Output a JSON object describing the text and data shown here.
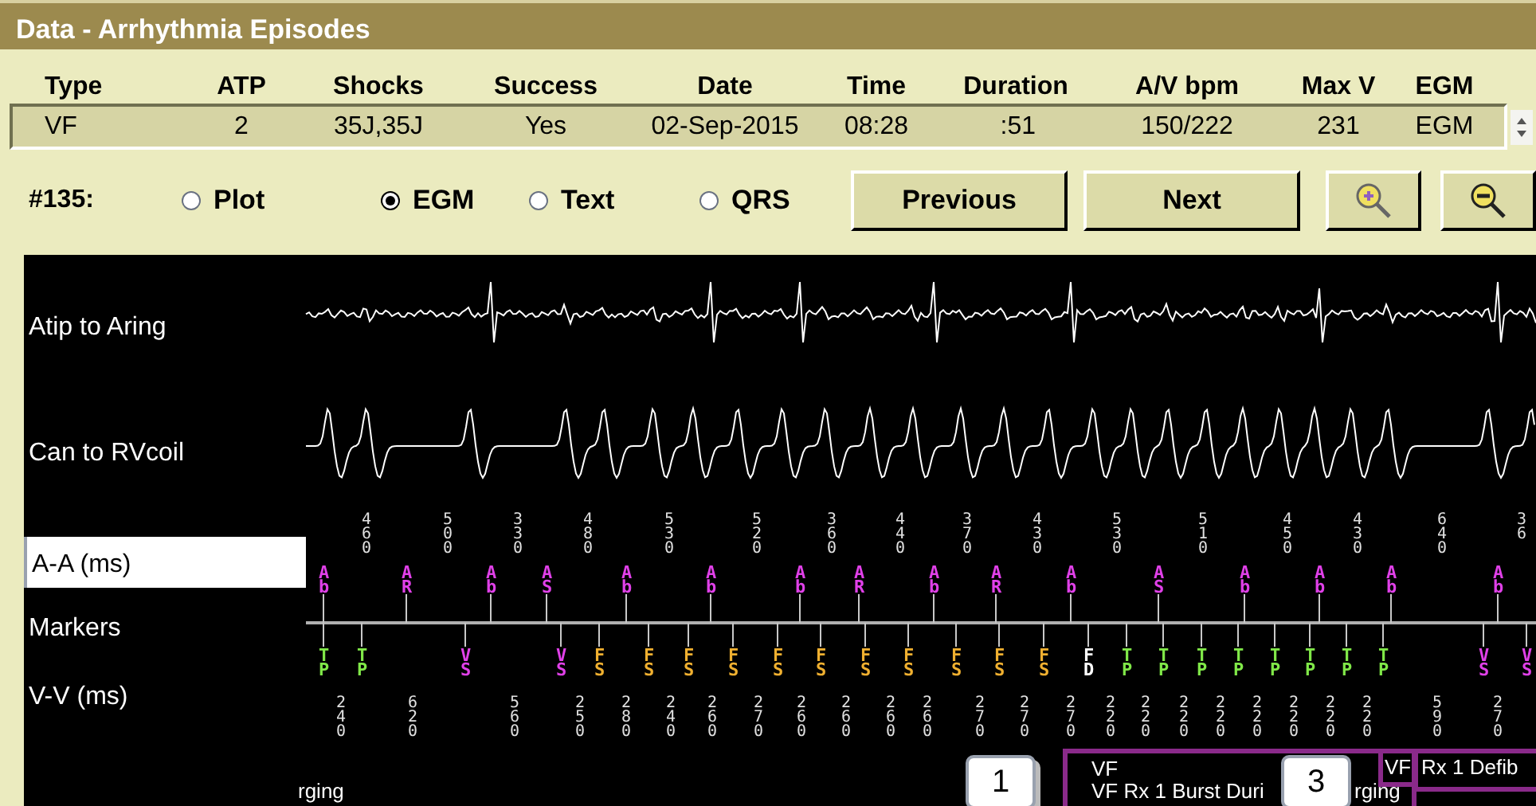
{
  "window": {
    "title": "Data - Arrhythmia Episodes"
  },
  "table": {
    "columns": [
      "Type",
      "ATP",
      "Shocks",
      "Success",
      "Date",
      "Time",
      "Duration",
      "A/V bpm",
      "Max V",
      "EGM"
    ],
    "rows": [
      {
        "cells": [
          "VF",
          "2",
          "35J,35J",
          "Yes",
          "02-Sep-2015",
          "08:28",
          ":51",
          "150/222",
          "231",
          "EGM"
        ],
        "selected": true
      }
    ]
  },
  "episode_label": "#135:",
  "view_options": [
    {
      "label": "Plot",
      "selected": false
    },
    {
      "label": "EGM",
      "selected": true
    },
    {
      "label": "Text",
      "selected": false
    },
    {
      "label": "QRS",
      "selected": false
    }
  ],
  "buttons": [
    "Previous",
    "Next"
  ],
  "channels": [
    {
      "label": "Atip to Aring"
    },
    {
      "label": "Can to RVcoil"
    }
  ],
  "aa": {
    "label": "A-A (ms)",
    "intervals": [
      "460",
      "500",
      "330",
      "480",
      "530",
      "520",
      "360",
      "440",
      "370",
      "430",
      "530",
      "510",
      "450",
      "430",
      "640",
      "36"
    ]
  },
  "markers": {
    "label": "Markers",
    "atrial": [
      {
        "text": "Ab",
        "color": "#e040e8"
      },
      {
        "text": "AR",
        "color": "#e040e8"
      },
      {
        "text": "Ab",
        "color": "#e040e8"
      },
      {
        "text": "AS",
        "color": "#e040e8"
      },
      {
        "text": "Ab",
        "color": "#e040e8"
      },
      {
        "text": "Ab",
        "color": "#e040e8"
      },
      {
        "text": "Ab",
        "color": "#e040e8"
      },
      {
        "text": "AR",
        "color": "#e040e8"
      },
      {
        "text": "Ab",
        "color": "#e040e8"
      },
      {
        "text": "AR",
        "color": "#e040e8"
      },
      {
        "text": "Ab",
        "color": "#e040e8"
      },
      {
        "text": "AS",
        "color": "#e040e8"
      },
      {
        "text": "Ab",
        "color": "#e040e8"
      },
      {
        "text": "Ab",
        "color": "#e040e8"
      },
      {
        "text": "Ab",
        "color": "#e040e8"
      },
      {
        "text": "Ab",
        "color": "#e040e8"
      }
    ],
    "ventricular": [
      {
        "text": "TP",
        "color": "#80e848"
      },
      {
        "text": "TP",
        "color": "#80e848"
      },
      {
        "text": "VS",
        "color": "#e040e8"
      },
      {
        "text": "VS",
        "color": "#e040e8"
      },
      {
        "text": "FS",
        "color": "#f0b030"
      },
      {
        "text": "FS",
        "color": "#f0b030"
      },
      {
        "text": "FS",
        "color": "#f0b030"
      },
      {
        "text": "FS",
        "color": "#f0b030"
      },
      {
        "text": "FS",
        "color": "#f0b030"
      },
      {
        "text": "FS",
        "color": "#f0b030"
      },
      {
        "text": "FS",
        "color": "#f0b030"
      },
      {
        "text": "FS",
        "color": "#f0b030"
      },
      {
        "text": "FS",
        "color": "#f0b030"
      },
      {
        "text": "FS",
        "color": "#f0b030"
      },
      {
        "text": "FS",
        "color": "#f0b030"
      },
      {
        "text": "FD",
        "color": "#ffffff"
      },
      {
        "text": "TP",
        "color": "#80e848"
      },
      {
        "text": "TP",
        "color": "#80e848"
      },
      {
        "text": "TP",
        "color": "#80e848"
      },
      {
        "text": "TP",
        "color": "#80e848"
      },
      {
        "text": "TP",
        "color": "#80e848"
      },
      {
        "text": "TP",
        "color": "#80e848"
      },
      {
        "text": "TP",
        "color": "#80e848"
      },
      {
        "text": "TP",
        "color": "#80e848"
      },
      {
        "text": "VS",
        "color": "#e040e8"
      },
      {
        "text": "VS",
        "color": "#e040e8"
      }
    ]
  },
  "vv": {
    "label": "V-V (ms)",
    "intervals": [
      "240",
      "620",
      "560",
      "250",
      "280",
      "240",
      "260",
      "270",
      "260",
      "260",
      "260",
      "260",
      "270",
      "270",
      "270",
      "220",
      "220",
      "220",
      "220",
      "220",
      "220",
      "220",
      "220",
      "590",
      "270"
    ]
  },
  "annotations": {
    "left_text": "rging",
    "badges": [
      "1",
      "3"
    ],
    "episode_lines": [
      "VF",
      "VF Rx 1 Burst Duri"
    ],
    "episode_tail": "rging",
    "detect_label": "VF",
    "therapy_label": "Rx 1 Defib"
  }
}
